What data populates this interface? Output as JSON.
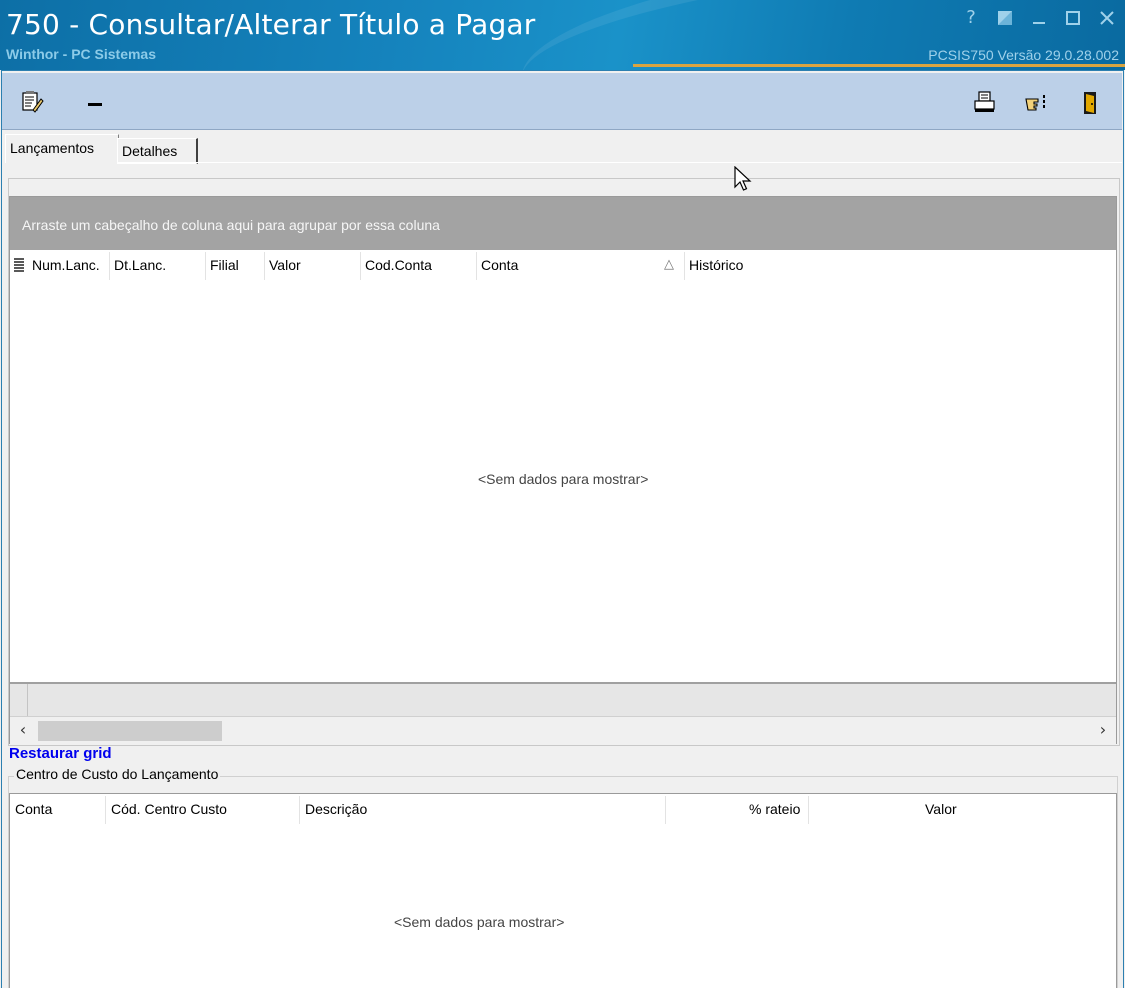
{
  "window": {
    "title": "750 - Consultar/Alterar Título a Pagar",
    "subtitle": "Winthor - PC Sistemas",
    "version": "PCSIS750  Versão  29.0.28.002",
    "controls": [
      "help-icon",
      "restore-icon",
      "minimize-icon",
      "maximize-icon",
      "close-icon"
    ]
  },
  "toolbar": {
    "left_buttons": [
      "notes-edit-icon",
      "minus-icon"
    ],
    "right_buttons": [
      "printer-icon",
      "pointing-hand-icon",
      "exit-door-icon"
    ]
  },
  "tabs": [
    {
      "label": "Lançamentos",
      "active": true
    },
    {
      "label": "Detalhes",
      "active": false
    }
  ],
  "lancamentos_grid": {
    "group_panel_text": "Arraste um cabeçalho de coluna aqui para agrupar por essa coluna",
    "columns": [
      "Num.Lanc.",
      "Dt.Lanc.",
      "Filial",
      "Valor",
      "Cod.Conta",
      "Conta",
      "Histórico"
    ],
    "sorted_column": "Conta",
    "sort_indicator": "△",
    "empty_text": "<Sem dados para mostrar>",
    "rows": []
  },
  "restaurar_link": "Restaurar grid",
  "centro_custo": {
    "legend": "Centro de Custo do Lançamento",
    "columns": [
      "Conta",
      "Cód. Centro Custo",
      "Descrição",
      "% rateio",
      "Valor"
    ],
    "empty_text": "<Sem dados para mostrar>",
    "rows": []
  }
}
